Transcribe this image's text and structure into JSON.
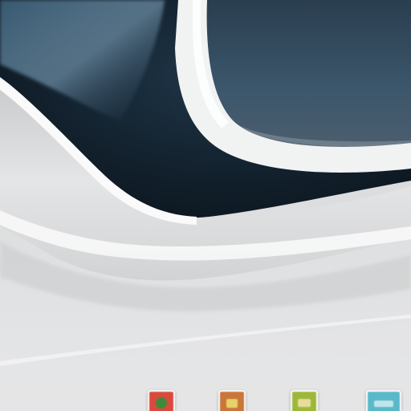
{
  "wallpaper": {
    "description_colors": {
      "dark_blue": "#0f1c27",
      "steel_blue": "#3f6580",
      "silver": "#d9dadb",
      "white": "#f5f5f5"
    }
  },
  "dock": {
    "icons": [
      {
        "name": "app-icon-1",
        "color": "#d94a3d",
        "accent": "#3e8a3a",
        "icon": "photo-icon"
      },
      {
        "name": "app-icon-2",
        "color": "#c9763a",
        "accent": "#e8d06a",
        "icon": "notes-icon"
      },
      {
        "name": "app-icon-3",
        "color": "#9cb83a",
        "accent": "#e8dc9a",
        "icon": "folder-icon"
      },
      {
        "name": "app-icon-4",
        "color": "#5ab9c9",
        "accent": "#bfe6ec",
        "icon": "screen-icon"
      }
    ]
  }
}
